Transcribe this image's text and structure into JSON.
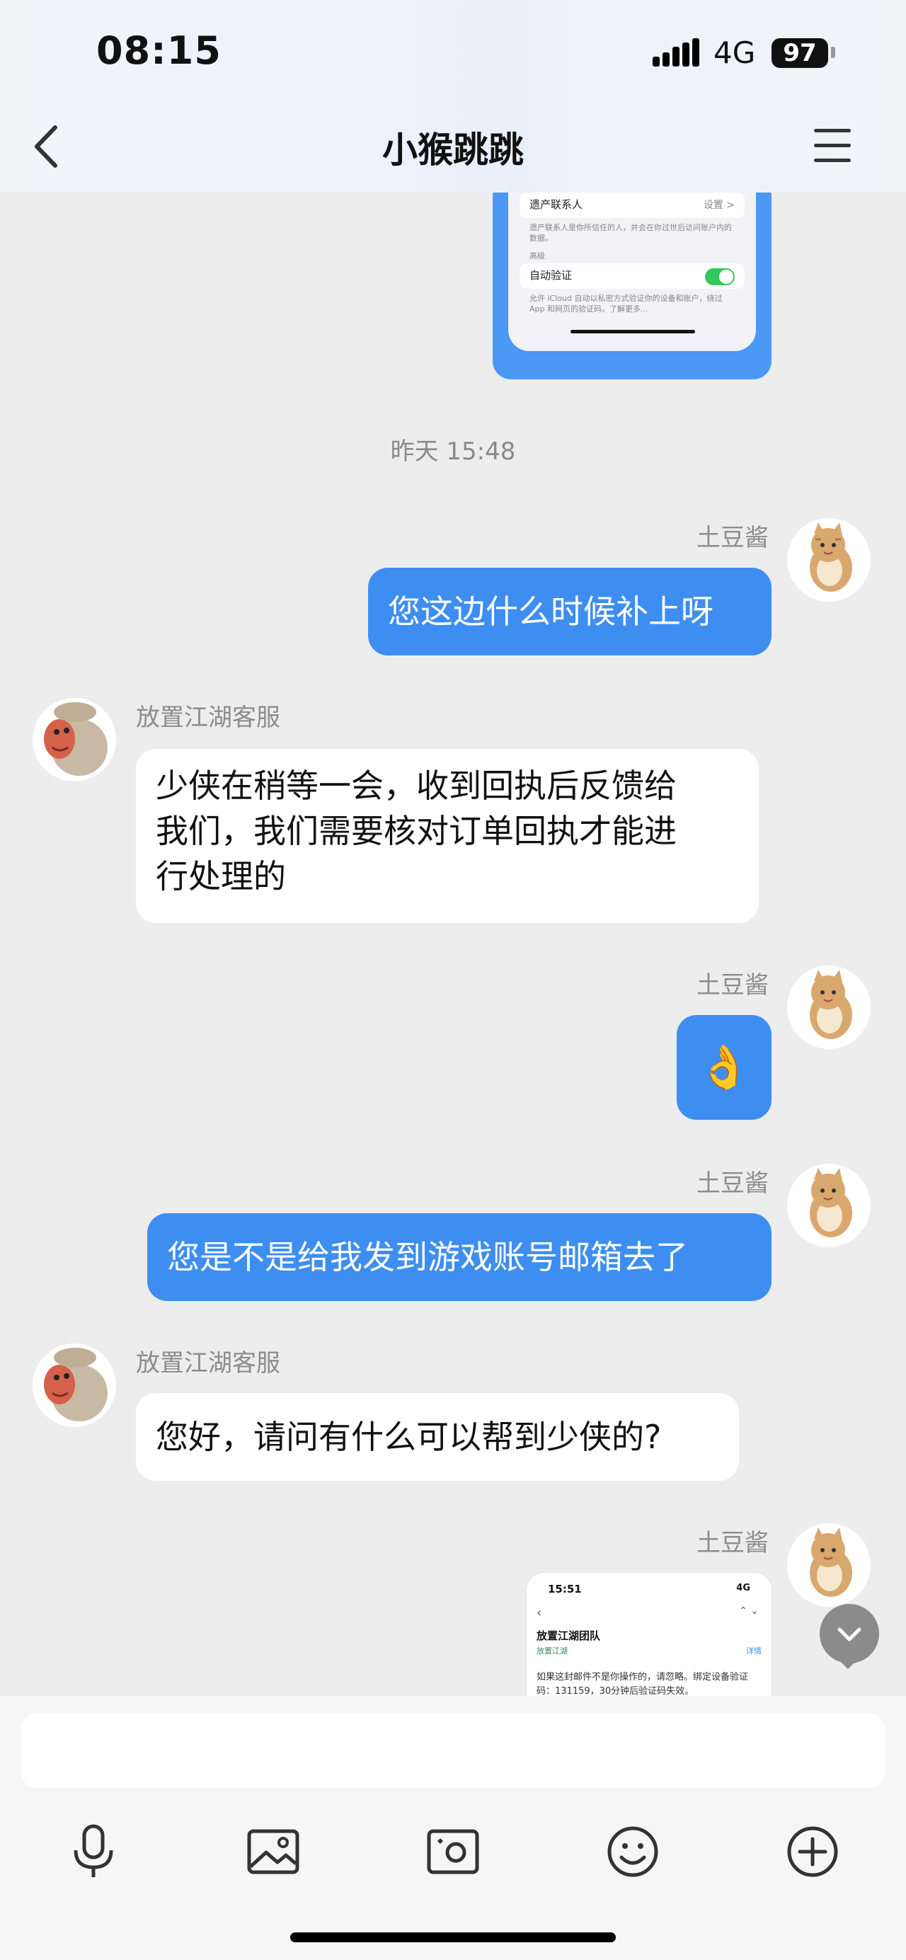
{
  "status_bar": {
    "time": "08:15",
    "network": "4G",
    "battery": "97"
  },
  "header": {
    "title": "小猴跳跳",
    "back_icon": "chevron-left-icon",
    "menu_icon": "hamburger-menu-icon"
  },
  "screenshot_top": {
    "row1_label": "遗产联系人",
    "row1_value": "设置 >",
    "note1": "遗产联系人是你所信任的人，并会在你过世后访问账户内的数据。",
    "section": "高级",
    "row2_label": "自动验证",
    "note2": "允许 iCloud 自动以私密方式验证你的设备和账户，绕过 App 和网页的验证码。了解更多..."
  },
  "timestamp": "昨天 15:48",
  "messages": [
    {
      "direction": "out",
      "sender": "土豆酱",
      "text": "您这边什么时候补上呀"
    },
    {
      "direction": "in",
      "sender": "放置江湖客服",
      "lines": [
        "少侠在稍等一会，收到回执后反馈给",
        "我们，我们需要核对订单回执才能进",
        "行处理的"
      ]
    },
    {
      "direction": "out",
      "sender": "土豆酱",
      "text": "👌"
    },
    {
      "direction": "out",
      "sender": "土豆酱",
      "text": "您是不是给我发到游戏账号邮箱去了"
    },
    {
      "direction": "in",
      "sender": "放置江湖客服",
      "text": "您好，请问有什么可以帮到少侠的?"
    },
    {
      "direction": "out",
      "sender": "土豆酱",
      "type": "image"
    }
  ],
  "screenshot_bottom": {
    "time": "15:51",
    "net": "4G",
    "sender": "放置江湖团队",
    "sub": "放置江湖",
    "detail": "详情",
    "body1": "如果这封邮件不是你操作的，请忽略。绑定设备验证",
    "body2": "码：131159，30分钟后验证码失效。"
  },
  "input": {
    "placeholder": ""
  },
  "toolbar": {
    "icons": [
      "microphone-icon",
      "image-icon",
      "camera-icon",
      "emoji-icon",
      "plus-icon"
    ]
  },
  "colors": {
    "accent": "#3d8ef0",
    "background": "#ededed",
    "toggle": "#34c759"
  }
}
